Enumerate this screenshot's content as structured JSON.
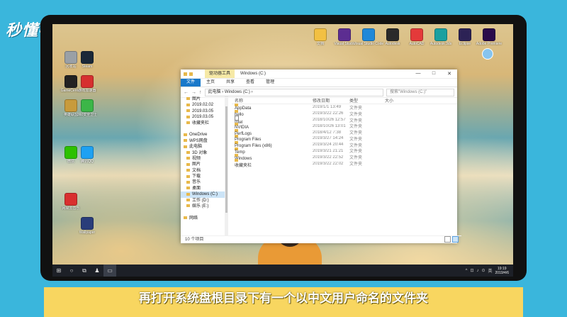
{
  "logo_text": "秒懂视频",
  "subtitle": "再打开系统盘根目录下有一个以中文用户命名的文件夹",
  "desktop_icons": [
    {
      "label": "回收站",
      "color": "#9aa0a6"
    },
    {
      "label": "Steam",
      "color": "#1b2838"
    },
    {
      "label": "GameCenter",
      "color": "#222222"
    },
    {
      "label": "游戏加速器",
      "color": "#d62f2f"
    },
    {
      "label": "英雄联盟",
      "color": "#c89b3c"
    },
    {
      "label": "360安全卫士",
      "color": "#3cb648"
    },
    {
      "label": "微信",
      "color": "#2dc100"
    },
    {
      "label": "腾讯QQ",
      "color": "#1ea1f2"
    },
    {
      "label": "网易云音乐",
      "color": "#d92f2f"
    },
    {
      "label": "Wallpaper",
      "color": "#2a3d7a"
    }
  ],
  "top_icons": [
    {
      "label": "文档",
      "color": "#f2c043"
    },
    {
      "label": "Visual Studio",
      "color": "#5c2d91"
    },
    {
      "label": "Visual Studio Code",
      "color": "#1f88d9"
    },
    {
      "label": "Autodesk",
      "color": "#2a2a2a"
    },
    {
      "label": "AutoCAD",
      "color": "#e43a3a"
    },
    {
      "label": "Autodesk 3ds",
      "color": "#1aa0a0"
    },
    {
      "label": "Eclipse",
      "color": "#2c2255"
    },
    {
      "label": "Adobe Premiere",
      "color": "#2a0a4a"
    }
  ],
  "explorer": {
    "title": "Windows (C:)",
    "tool_tab": "驱动器工具",
    "ribbon_tabs": [
      "文件",
      "主页",
      "共享",
      "查看",
      "管理"
    ],
    "back": "←",
    "forward": "→",
    "up": "↑",
    "address": "此电脑 › Windows (C:) ›",
    "search_placeholder": "搜索\"Windows (C:)\"",
    "nav_items": [
      {
        "label": "图片",
        "level": 1
      },
      {
        "label": "2019.02.02",
        "level": 1
      },
      {
        "label": "2019.03.05",
        "level": 1
      },
      {
        "label": "2019.03.05",
        "level": 1
      },
      {
        "label": "收藏夹栏",
        "level": 1
      },
      {
        "label": "",
        "level": 0
      },
      {
        "label": "OneDrive",
        "level": 0
      },
      {
        "label": "WPS网盘",
        "level": 0
      },
      {
        "label": "此电脑",
        "level": 0
      },
      {
        "label": "3D 对象",
        "level": 1
      },
      {
        "label": "视频",
        "level": 1
      },
      {
        "label": "图片",
        "level": 1
      },
      {
        "label": "文档",
        "level": 1
      },
      {
        "label": "下载",
        "level": 1
      },
      {
        "label": "音乐",
        "level": 1
      },
      {
        "label": "桌面",
        "level": 1
      },
      {
        "label": "Windows (C:)",
        "level": 1,
        "selected": true
      },
      {
        "label": "工作 (D:)",
        "level": 1
      },
      {
        "label": "娱乐 (E:)",
        "level": 1
      },
      {
        "label": "",
        "level": 0
      },
      {
        "label": "网络",
        "level": 0
      }
    ],
    "columns": [
      "名称",
      "修改日期",
      "类型",
      "大小"
    ],
    "files": [
      {
        "name": "AppData",
        "date": "2019/1/1 13:49",
        "type": "文件夹",
        "doc": false
      },
      {
        "name": "hello",
        "date": "2019/3/22 22:26",
        "type": "文件夹",
        "doc": false
      },
      {
        "name": "Intel",
        "date": "2018/10/26 12:57",
        "type": "文件夹",
        "doc": true
      },
      {
        "name": "NVIDIA",
        "date": "2018/10/26 13:01",
        "type": "文件夹",
        "doc": false
      },
      {
        "name": "PerfLogs",
        "date": "2018/4/12 7:38",
        "type": "文件夹",
        "doc": false
      },
      {
        "name": "Program Files",
        "date": "2019/3/27 14:24",
        "type": "文件夹",
        "doc": false
      },
      {
        "name": "Program Files (x86)",
        "date": "2019/3/24 20:44",
        "type": "文件夹",
        "doc": false
      },
      {
        "name": "Temp",
        "date": "2019/3/21 21:21",
        "type": "文件夹",
        "doc": false
      },
      {
        "name": "Windows",
        "date": "2019/3/22 22:52",
        "type": "文件夹",
        "doc": false
      },
      {
        "name": "收藏夹栏",
        "date": "2019/3/22 22:02",
        "type": "文件夹",
        "doc": false
      }
    ],
    "status": "10 个项目"
  },
  "taskbar": {
    "start": "⊞",
    "search": "○",
    "taskview": "⧉",
    "apps": [
      "♟",
      "▭"
    ],
    "tray": [
      "^",
      "⊡",
      "♪",
      "⊙",
      "英"
    ],
    "time": "19:19",
    "date": "2019/4/6"
  }
}
